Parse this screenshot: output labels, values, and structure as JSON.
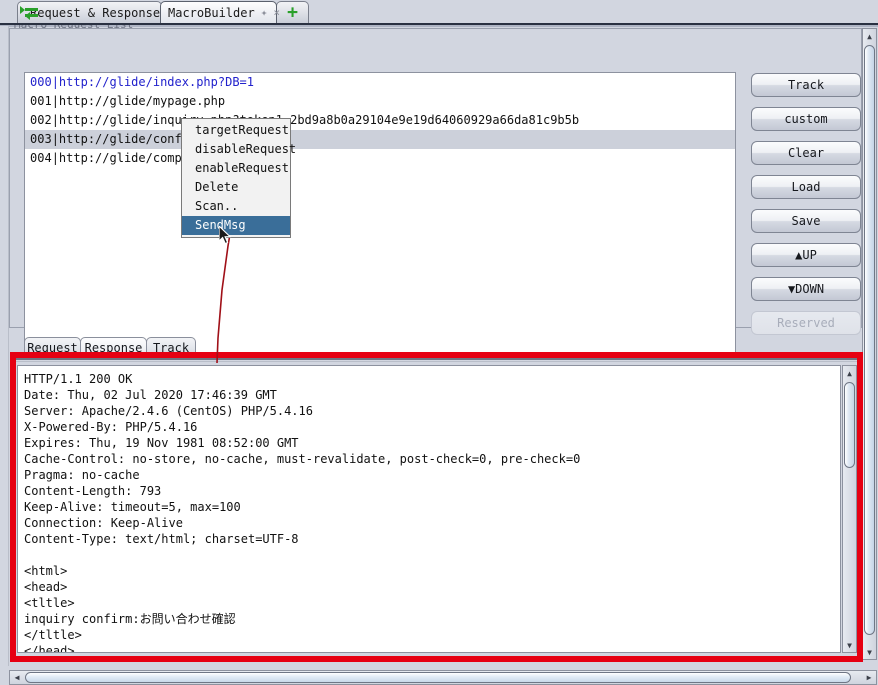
{
  "window": {
    "group_label": "Macro Request List"
  },
  "tabs": [
    {
      "id": "request-response",
      "label": "Request & Response",
      "icon": "swap-arrows-icon",
      "active": false
    },
    {
      "id": "macrobuilder",
      "label": "MacroBuilder",
      "icon": "pin-icon",
      "close": "×",
      "active": true
    },
    {
      "id": "add-tab",
      "label": "+",
      "icon": "plus-icon",
      "active": false
    }
  ],
  "request_list": {
    "rows": [
      {
        "index": "000",
        "sep": "|",
        "url": "http://glide/index.php?DB=1",
        "style": "first"
      },
      {
        "index": "001",
        "sep": "|",
        "url": "http://glide/mypage.php",
        "style": "normal"
      },
      {
        "index": "002",
        "sep": "|",
        "url": "http://glide/inquiry.php?token1=2bd9a8b0a29104e9e19d64060929a66da81c9b5b",
        "style": "normal"
      },
      {
        "index": "003",
        "sep": "|",
        "url": "http://glide/confirm.php",
        "style": "selected"
      },
      {
        "index": "004",
        "sep": "|",
        "url": "http://glide/complete.php",
        "style": "normal"
      }
    ]
  },
  "side_buttons": [
    {
      "label": "Track",
      "disabled": false
    },
    {
      "label": "custom",
      "disabled": false
    },
    {
      "label": "Clear",
      "disabled": false
    },
    {
      "label": "Load",
      "disabled": false
    },
    {
      "label": "Save",
      "disabled": false
    },
    {
      "label": "▲UP",
      "disabled": false
    },
    {
      "label": "▼DOWN",
      "disabled": false
    },
    {
      "label": "Reserved",
      "disabled": true
    }
  ],
  "context_menu": {
    "items": [
      {
        "label": "targetRequest",
        "highlight": false
      },
      {
        "label": "disableRequest",
        "highlight": false
      },
      {
        "label": "enableRequest",
        "highlight": false
      },
      {
        "label": "Delete",
        "highlight": false
      },
      {
        "label": "Scan..",
        "highlight": false
      },
      {
        "label": "SendMsg",
        "highlight": true
      }
    ]
  },
  "lower_tabs": [
    {
      "id": "request",
      "label": "Request",
      "active": false
    },
    {
      "id": "response",
      "label": "Response",
      "active": true
    },
    {
      "id": "track",
      "label": "Track",
      "active": false
    }
  ],
  "response": {
    "lines": [
      "HTTP/1.1 200 OK",
      "Date: Thu, 02 Jul 2020 17:46:39 GMT",
      "Server: Apache/2.4.6 (CentOS) PHP/5.4.16",
      "X-Powered-By: PHP/5.4.16",
      "Expires: Thu, 19 Nov 1981 08:52:00 GMT",
      "Cache-Control: no-store, no-cache, must-revalidate, post-check=0, pre-check=0",
      "Pragma: no-cache",
      "Content-Length: 793",
      "Keep-Alive: timeout=5, max=100",
      "Connection: Keep-Alive",
      "Content-Type: text/html; charset=UTF-8",
      "",
      "<html>",
      "<head>",
      "<tltle>",
      "inquiry confirm:お問い合わせ確認",
      "</tltle>",
      "</head>"
    ]
  },
  "annotation": {
    "box_color": "#e60012",
    "line_color": "#a01018"
  },
  "scroll": {
    "up_arrow": "▲",
    "down_arrow": "▼",
    "left_arrow": "◀",
    "right_arrow": "▶"
  },
  "colors": {
    "highlight": "#3a6e99",
    "selection": "#ccd0da",
    "link_text": "#2222cc",
    "accent_green": "#2aa02a"
  }
}
